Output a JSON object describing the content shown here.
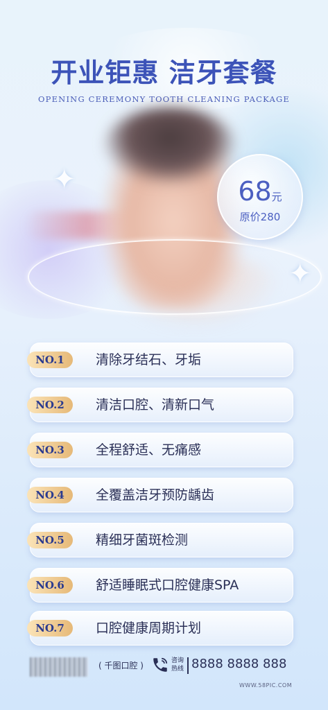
{
  "header": {
    "title": "开业钜惠 洁牙套餐",
    "subtitle": "OPENING CEREMONY TOOTH CLEANING PACKAGE"
  },
  "price": {
    "value": "68",
    "unit": "元",
    "original": "原价280"
  },
  "items": [
    {
      "badge": "NO.1",
      "text": "清除牙结石、牙垢"
    },
    {
      "badge": "NO.2",
      "text": "清洁口腔、清新口气"
    },
    {
      "badge": "NO.3",
      "text": "全程舒适、无痛感"
    },
    {
      "badge": "NO.4",
      "text": "全覆盖洁牙预防龋齿"
    },
    {
      "badge": "NO.5",
      "text": "精细牙菌斑检测"
    },
    {
      "badge": "NO.6",
      "text": "舒适睡眠式口腔健康SPA"
    },
    {
      "badge": "NO.7",
      "text": "口腔健康周期计划"
    }
  ],
  "footer": {
    "brand": "( 千图口腔 )",
    "hotline_label": "咨询热线",
    "phone": "8888 8888 888",
    "website": "WWW.58PIC.COM"
  },
  "icons": {
    "phone": "phone-icon",
    "sparkle": "sparkle-icon"
  },
  "colors": {
    "title": "#3c53b8",
    "badge_gold": "#e6b978",
    "text": "#2a2f56"
  }
}
